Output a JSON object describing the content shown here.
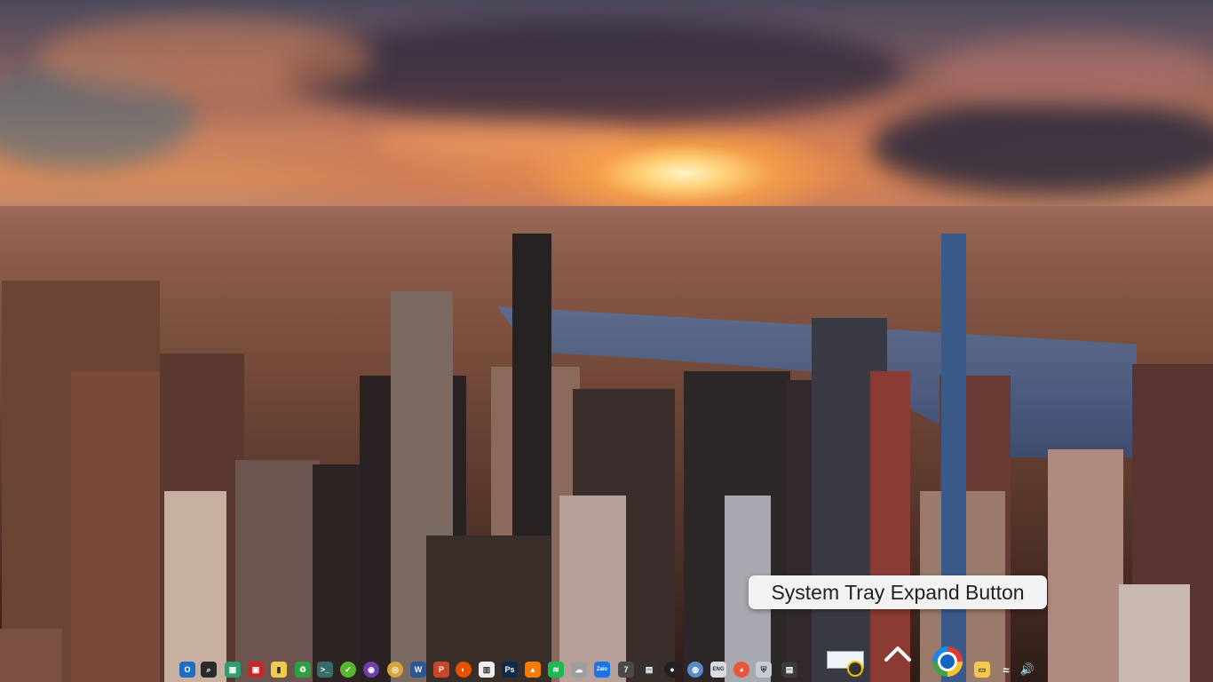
{
  "tooltip": {
    "text": "System Tray Expand Button"
  },
  "taskbar": {
    "apps": [
      {
        "name": "outlook-icon",
        "glyph": "O",
        "color": "#1e6ec8"
      },
      {
        "name": "search-icon",
        "glyph": "⌕",
        "color": "#2b2b2b"
      },
      {
        "name": "apps-grid-icon",
        "glyph": "▦",
        "color": "#2e9e6e"
      },
      {
        "name": "flag-app-icon",
        "glyph": "▣",
        "color": "#c62828"
      },
      {
        "name": "sticky-note-icon",
        "glyph": "▮",
        "color": "#f2c94c"
      },
      {
        "name": "recycle-icon",
        "glyph": "♻",
        "color": "#2ea043"
      },
      {
        "name": "terminal-icon",
        "glyph": ">_",
        "color": "#3a6b6b"
      },
      {
        "name": "green-app-icon",
        "glyph": "✓",
        "color": "#5ab52f"
      },
      {
        "name": "github-icon",
        "glyph": "◉",
        "color": "#6e3fa8"
      },
      {
        "name": "chrome-icon",
        "glyph": "◎",
        "color": "#d9a33a"
      },
      {
        "name": "word-icon",
        "glyph": "W",
        "color": "#2b5797"
      },
      {
        "name": "powerpoint-icon",
        "glyph": "P",
        "color": "#c8472a"
      },
      {
        "name": "browser-icon",
        "glyph": "◐",
        "color": "#e65100"
      },
      {
        "name": "trello-icon",
        "glyph": "▥",
        "color": "#eeeeee"
      },
      {
        "name": "photoshop-icon",
        "glyph": "Ps",
        "color": "#0c2a4a"
      },
      {
        "name": "vlc-icon",
        "glyph": "▲",
        "color": "#f57c00"
      },
      {
        "name": "spotify-icon",
        "glyph": "≋",
        "color": "#1db954"
      },
      {
        "name": "cloud-icon",
        "glyph": "☁",
        "color": "#9e9e9e"
      },
      {
        "name": "zalo-icon",
        "glyph": "Zalo",
        "color": "#1a73e8"
      },
      {
        "name": "calendar-icon",
        "glyph": "7",
        "color": "#4a4a4a"
      },
      {
        "name": "monitor-icon",
        "glyph": "▤",
        "color": "#333333"
      },
      {
        "name": "disc-icon",
        "glyph": "●",
        "color": "#222222"
      },
      {
        "name": "photo-viewer-icon",
        "glyph": "◍",
        "color": "#5a8ac8"
      },
      {
        "name": "keyboard-icon",
        "glyph": "ENG",
        "color": "#d7dde3"
      },
      {
        "name": "edge-icon",
        "glyph": "◕",
        "color": "#e8553a"
      },
      {
        "name": "shield-icon",
        "glyph": "⛨",
        "color": "#c7ccd3"
      },
      {
        "name": "notification-icon",
        "glyph": "▤",
        "color": "#3a3a3a"
      }
    ],
    "tray": [
      {
        "name": "folder-icon",
        "glyph": "▭",
        "color": "#f2c94c"
      },
      {
        "name": "wifi-icon",
        "glyph": "≈",
        "color": "#ffffff"
      },
      {
        "name": "volume-icon",
        "glyph": "🔊",
        "color": "#ffffff"
      }
    ]
  }
}
